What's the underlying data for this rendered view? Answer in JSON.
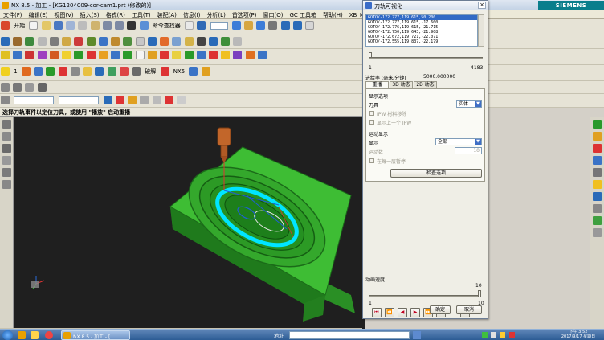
{
  "app": {
    "title": "NX 8.5 - 加工 - [KG1204009-cor-cam1.prt  (修改的)]",
    "brand": "SIEMENS",
    "window_controls": [
      "_",
      "□",
      "×"
    ]
  },
  "menu": [
    "文件(F)",
    "编辑(E)",
    "视图(V)",
    "插入(S)",
    "格式(R)",
    "工具(T)",
    "装配(A)",
    "信息(I)",
    "分析(L)",
    "首选项(P)",
    "窗口(O)",
    "GC 工具箱",
    "帮助(H)",
    "XB_MOULD"
  ],
  "toolbar": {
    "start_label": "开始",
    "command_finder_label": "命令查找器",
    "break_label": "破解",
    "nx5_label": "NX5",
    "combo1": "",
    "combo2": "",
    "label_a": "",
    "label_b": "1"
  },
  "cue_line": "选择刀轨事件以定位刀具，或使用 \"播放\" 启动重播",
  "dialog": {
    "title": "刀轨可视化",
    "goto_lines": [
      "GOTO/-172.777,119.615,50.200",
      "GOTO/-172.777,119.615,-17.600",
      "GOTO/-172.776,119.615,-21.715",
      "GOTO/-172.750,119.643,-21.908",
      "GOTO/-172.672,119.721,-22.071",
      "GOTO/-172.555,119.837,-22.179"
    ],
    "slider_min": "1",
    "slider_max": "4183",
    "slider_value": 0.0,
    "feed_label": "进给率 (毫米/分钟)",
    "feed_value": "5000.000000",
    "tabs": [
      "重播",
      "3D 动态",
      "2D 动态"
    ],
    "display_options_label": "显示选项",
    "tool_label": "刀具",
    "tool_value": "实体",
    "ipw_label": "IPW 材料移除",
    "show_before_label": "显示上一个 IPW",
    "motion_display_label": "运动显示",
    "display_label": "显示",
    "display_value": "全部",
    "motion_count_label": "运动数",
    "motion_count_value": "10",
    "pause_each_label": "在每一层暂停",
    "check_options_button": "检查选项",
    "anim_speed_label": "动画速度",
    "speed_min": "1",
    "speed_max": "10",
    "speed_value": "10",
    "speed_level": 1.0,
    "ok_button": "确定",
    "cancel_button": "取消",
    "vcr_buttons": [
      "⏮",
      "⏪",
      "◀",
      "▶",
      "⏩",
      "⏭",
      "■"
    ]
  },
  "taskbar": {
    "task_label": "NX 8.5 - 加工 - [...",
    "address_label": "地址",
    "clock_time": "下午 3:52",
    "clock_date": "2017/9/17 星期日"
  },
  "colors": {
    "part_green": "#2fae2a",
    "toolpath_cyan": "#00e5ff",
    "tool_orange": "#c2662a",
    "viewport_bg": "#1f1f1f",
    "siemens_teal": "#0a7e8c"
  }
}
